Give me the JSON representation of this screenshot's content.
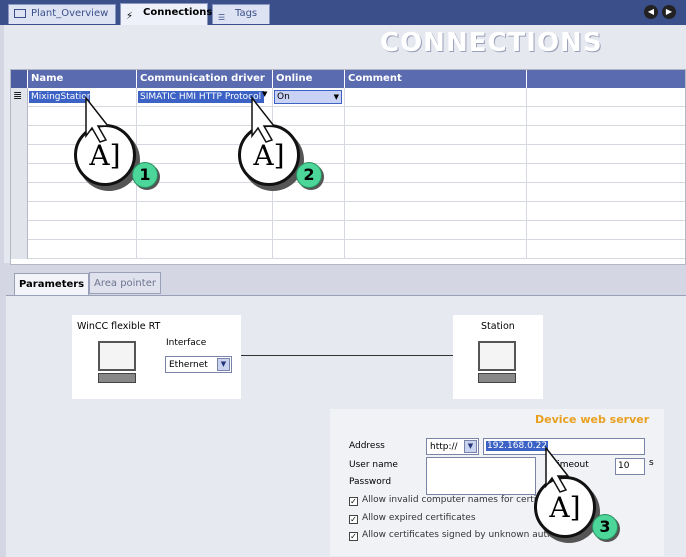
{
  "tabs": [
    {
      "label": "Plant_Overview",
      "active": false
    },
    {
      "label": "Connections",
      "active": true
    },
    {
      "label": "Tags",
      "active": false
    }
  ],
  "banner": "CONNECTIONS",
  "table": {
    "columns": [
      "Name",
      "Communication driver",
      "Online",
      "Comment"
    ],
    "row": {
      "name": "MixingStation",
      "driver": "SIMATIC HMI HTTP Protocol",
      "online": "On",
      "comment": ""
    }
  },
  "lower_tabs": [
    "Parameters",
    "Area pointer"
  ],
  "params": {
    "rt_title": "WinCC flexible RT",
    "interface_label": "Interface",
    "interface_value": "Ethernet",
    "station_title": "Station",
    "device_title": "Device web server",
    "address_label": "Address",
    "protocol_value": "http://",
    "address_value": "192.168.0.22",
    "username_label": "User name",
    "password_label": "Password",
    "timeout_label": "Timeout",
    "timeout_value": "10",
    "timeout_unit": "s",
    "checks": [
      "Allow invalid computer names for certificates",
      "Allow expired certificates",
      "Allow certificates signed by unknown authorities"
    ]
  },
  "callouts": [
    "1",
    "2",
    "3"
  ],
  "colors": {
    "header": "#5a6bb0",
    "accent": "#3b62c4",
    "device_title": "#e8a020",
    "callout_badge": "#4dd699"
  }
}
